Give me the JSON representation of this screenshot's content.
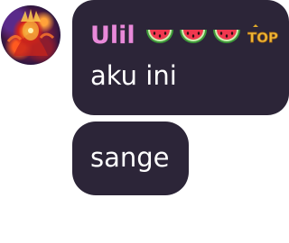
{
  "sender": {
    "name": "Ulil",
    "badges": [
      "watermelon-icon",
      "watermelon-icon",
      "watermelon-icon"
    ],
    "rank_badge": "TOP",
    "name_color": "#e889d9"
  },
  "messages": [
    {
      "text": "aku ini"
    },
    {
      "text": "sange"
    }
  ],
  "colors": {
    "bubble": "#2c2538",
    "text": "#ffffff",
    "background": "#ffffff"
  }
}
